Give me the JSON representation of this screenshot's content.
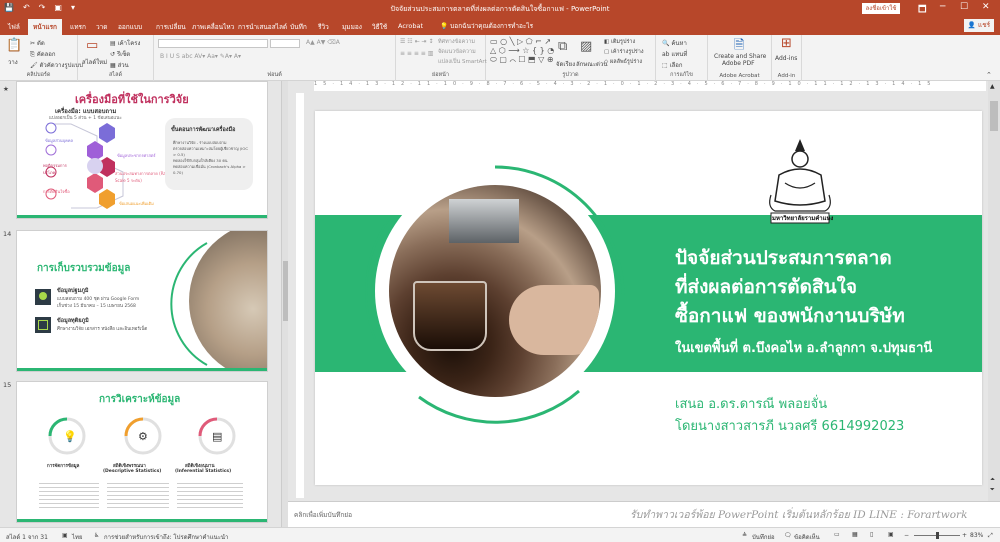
{
  "titlebar": {
    "title": "ปัจจัยส่วนประสมการตลาดที่ส่งผลต่อการตัดสินใจซื้อกาแฟ - PowerPoint",
    "signin": "ลงชื่อเข้าใช้",
    "quick_access": [
      "💾",
      "↶",
      "↷",
      "▣",
      "▾"
    ],
    "restore": "🗖",
    "minimize": "─",
    "maximize": "☐",
    "close": "✕"
  },
  "tabs": [
    "ไฟล์",
    "หน้าแรก",
    "แทรก",
    "วาด",
    "ออกแบบ",
    "การเปลี่ยน",
    "ภาพเคลื่อนไหว",
    "การนำเสนอสไลด์",
    "บันทึก",
    "รีวิว",
    "มุมมอง",
    "วิธีใช้",
    "Acrobat"
  ],
  "tellme": "บอกฉันว่าคุณต้องการทำอะไร",
  "share": "แชร์",
  "ribbon": {
    "clipboard": {
      "label": "คลิปบอร์ด",
      "paste": "วาง",
      "cut": "ตัด",
      "copy": "คัดลอก",
      "format": "ตัวคัดวางรูปแบบ"
    },
    "slides": {
      "label": "สไลด์",
      "new": "สไลด์ใหม่",
      "layout": "เค้าโครง",
      "reset": "รีเซ็ต",
      "section": "ส่วน"
    },
    "font": {
      "label": "ฟอนต์"
    },
    "paragraph": {
      "label": "ย่อหน้า",
      "direction": "ทิศทางข้อความ",
      "align": "จัดแนวข้อความ",
      "smartart": "แปลงเป็น SmartArt"
    },
    "drawing": {
      "label": "รูปวาด",
      "arrange": "จัดเรียง",
      "quickstyles": "ลักษณะด่วน",
      "fill": "เติมรูปร่าง",
      "outline": "เค้าร่างรูปร่าง",
      "effect": "ผลลัพธ์รูปร่าง"
    },
    "editing": {
      "label": "การแก้ไข",
      "find": "ค้นหา",
      "replace": "แทนที่",
      "select": "เลือก"
    },
    "acrobat": {
      "label": "Adobe Acrobat",
      "line1": "Create and Share",
      "line2": "Adobe PDF"
    },
    "addins": {
      "label": "Add-in",
      "button": "Add-ins"
    }
  },
  "thumbs": {
    "s13": {
      "title": "เครื่องมือที่ใช้ในการวิจัย",
      "tool_line": "เครื่องมือ: แบบสอบถาม",
      "tool_sub": "แบ่งออกเป็น 5 ส่วน + 1 ข้อเสนอแนะ",
      "box_title": "ขั้นตอนการพัฒนาเครื่องมือ",
      "box_items": [
        "ศึกษางานวิจัย - ร่างแบบสอบถาม",
        "ตรวจสอบความเหมาะสมโดยผู้เชี่ยวชาญ (IOC > 0.5)",
        "ทดลองใช้กับกลุ่มใกล้เคียง 30 คน",
        "ทดสอบความเชื่อมั่น (Cronbach's Alpha > 0.70)"
      ],
      "items": [
        "ข้อมูลส่วนบุคคล",
        "ข้อมูลประชากรศาสตร์",
        "พฤติกรรมการบริโภค",
        "ส่วนประสมทางการตลาด (Rating Scale 5 ระดับ)",
        "การตัดสินใจซื้อ",
        "ข้อเสนอแนะเพิ่มเติม"
      ]
    },
    "s14": {
      "num": "14",
      "title": "การเก็บรวบรวมข้อมูล",
      "p_head": "ข้อมูลปฐมภูมิ",
      "p_body1": "แบบสอบถาม 400 ชุด ผ่าน Google Form",
      "p_body2": "เก็บช่วง 15 มีนาคม – 15 เมษายน 2568",
      "s_head": "ข้อมูลทุติยภูมิ",
      "s_body": "ศึกษางานวิจัย เอกสาร หนังสือ และอินเทอร์เน็ต"
    },
    "s15": {
      "num": "15",
      "title": "การวิเคราะห์ข้อมูล",
      "c1": "การจัดการข้อมูล",
      "c2a": "สถิติเชิงพรรณนา",
      "c2b": "(Descriptive Statistics)",
      "c3a": "สถิติเชิงอนุมาน",
      "c3b": "(Inferential Statistics)"
    }
  },
  "slide": {
    "title1": "ปัจจัยส่วนประสมการตลาด",
    "title2": "ที่ส่งผลต่อการตัดสินใจ",
    "title3": "ซื้อกาแฟ ของพนักงานบริษัท",
    "sub": "ในเขตพื้นที่ ต.บึงคอไห อ.ลำลูกกา จ.ปทุมธานี",
    "present1": "เสนอ อ.ดร.ดารณี พลอยจั่น",
    "present2": "โดยนางสาวสารภี นวลศรี 6614992023",
    "logo_text": "มหาวิทยาลัยรามคำแหง"
  },
  "notes_placeholder": "คลิกเพื่อเพิ่มบันทึกย่อ",
  "watermark": "รับทำพาวเวอร์พ้อย PowerPoint เริ่มต้นหลักร้อย ID LINE : Forartwork",
  "ruler_text": "15·14·13·12·11·10·9·8·7·6·5·4·3·2·1·0·1·2·3·4·5·6·7·8·9·10·11·12·13·14·15",
  "status": {
    "slide": "สไลด์ 1 จาก 31",
    "lang": "ไทย",
    "access": "การช่วยสำหรับการเข้าถึง: โปรดศึกษาคำแนะนำ",
    "notes": "บันทึกย่อ",
    "comments": "ข้อคิดเห็น",
    "zoom": "83%"
  }
}
